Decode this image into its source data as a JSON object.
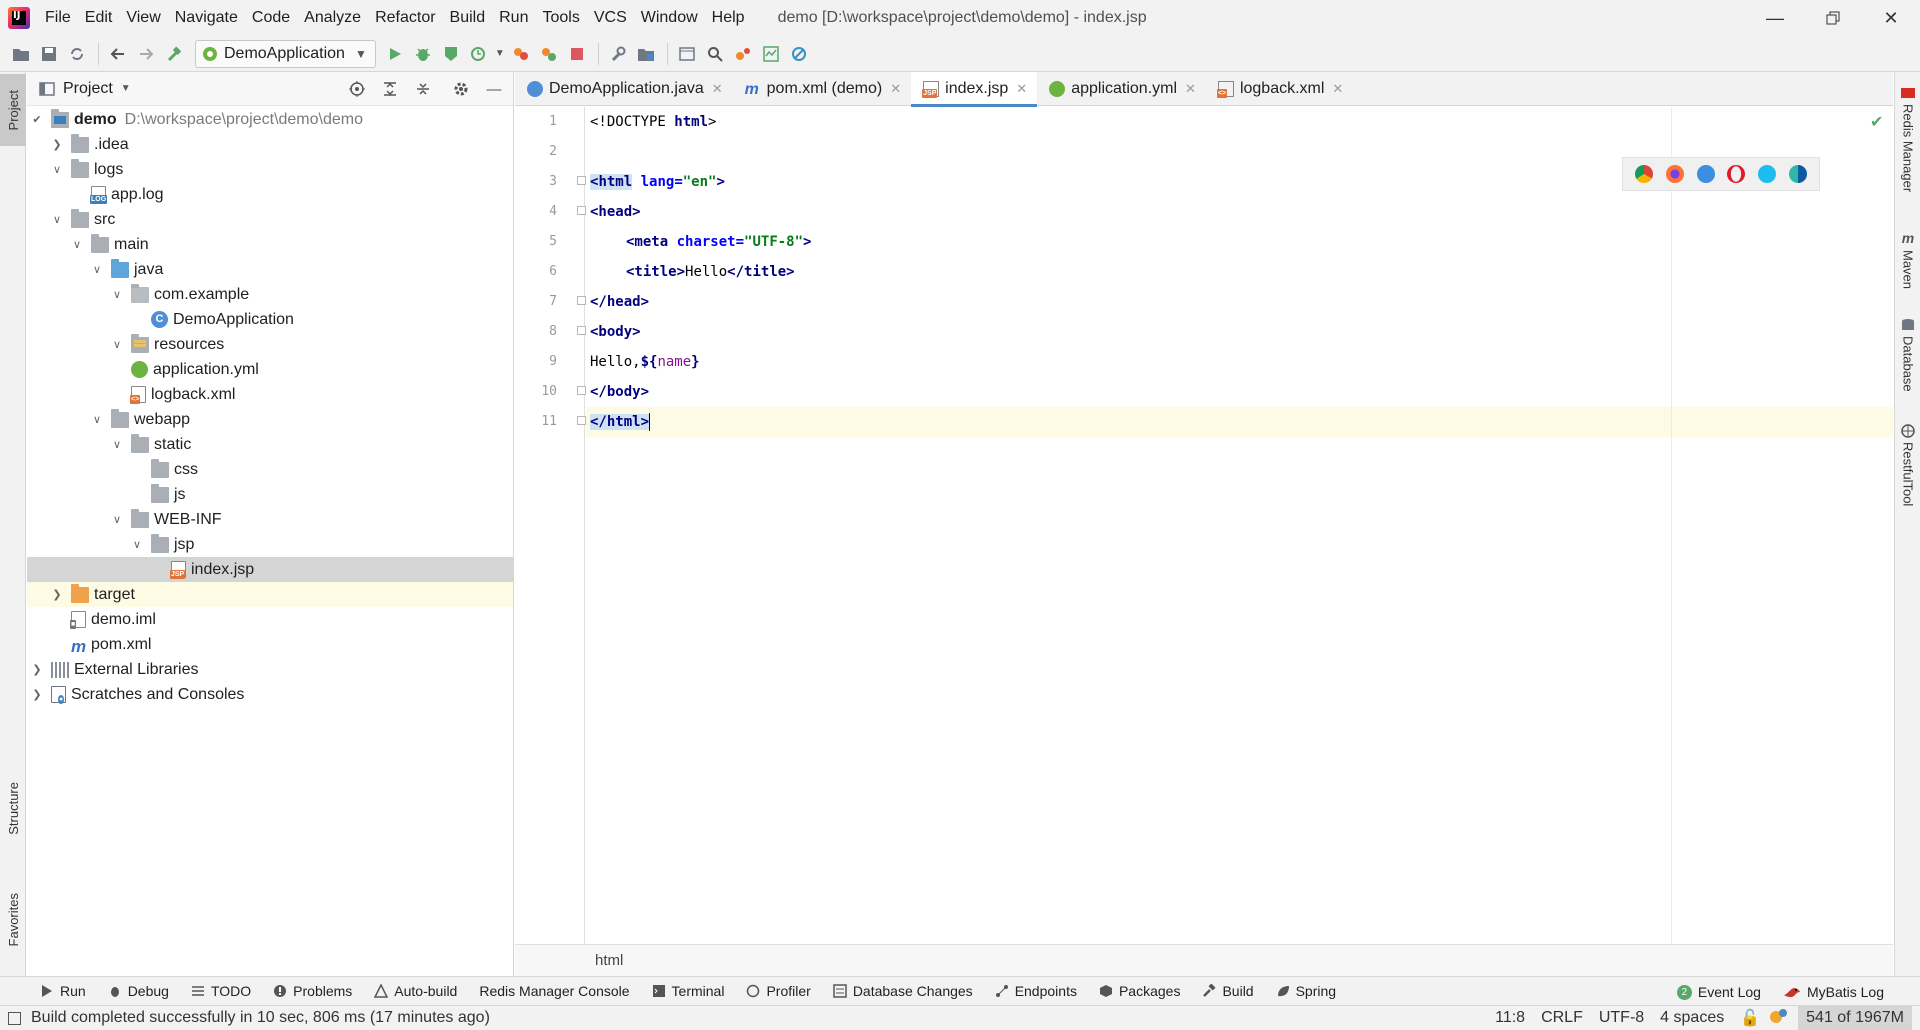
{
  "menu": {
    "items": [
      "File",
      "Edit",
      "View",
      "Navigate",
      "Code",
      "Analyze",
      "Refactor",
      "Build",
      "Run",
      "Tools",
      "VCS",
      "Window",
      "Help"
    ],
    "window_title": "demo [D:\\workspace\\project\\demo\\demo] - index.jsp"
  },
  "toolbar": {
    "run_config": "DemoApplication"
  },
  "left_stripe": {
    "project": "Project",
    "structure": "Structure",
    "favorites": "Favorites"
  },
  "right_stripe": {
    "redis": "Redis Manager",
    "maven": "Maven",
    "database": "Database",
    "restful": "RestfulTool"
  },
  "project_panel": {
    "title": "Project",
    "tree": [
      {
        "label": "demo",
        "path": "D:\\workspace\\project\\demo\\demo"
      },
      {
        "label": ".idea"
      },
      {
        "label": "logs"
      },
      {
        "label": "app.log"
      },
      {
        "label": "src"
      },
      {
        "label": "main"
      },
      {
        "label": "java"
      },
      {
        "label": "com.example"
      },
      {
        "label": "DemoApplication"
      },
      {
        "label": "resources"
      },
      {
        "label": "application.yml"
      },
      {
        "label": "logback.xml"
      },
      {
        "label": "webapp"
      },
      {
        "label": "static"
      },
      {
        "label": "css"
      },
      {
        "label": "js"
      },
      {
        "label": "WEB-INF"
      },
      {
        "label": "jsp"
      },
      {
        "label": "index.jsp"
      },
      {
        "label": "target"
      },
      {
        "label": "demo.iml"
      },
      {
        "label": "pom.xml"
      },
      {
        "label": "External Libraries"
      },
      {
        "label": "Scratches and Consoles"
      }
    ]
  },
  "editor": {
    "tabs": [
      {
        "label": "DemoApplication.java"
      },
      {
        "label": "pom.xml (demo)"
      },
      {
        "label": "index.jsp"
      },
      {
        "label": "application.yml"
      },
      {
        "label": "logback.xml"
      }
    ],
    "active_tab": "index.jsp",
    "line_numbers": [
      "1",
      "2",
      "3",
      "4",
      "5",
      "6",
      "7",
      "8",
      "9",
      "10",
      "11"
    ],
    "code": {
      "l1_doctype": "<!DOCTYPE ",
      "l1_html": "html",
      "l1_end": ">",
      "l3_open": "<",
      "l3_tag": "html",
      "l3_attr": " lang",
      "l3_eq": "=",
      "l3_val": "\"en\"",
      "l3_close": ">",
      "l4": "<head>",
      "l5_open": "<meta",
      "l5_attr": " charset",
      "l5_eq": "=",
      "l5_val": "\"UTF-8\"",
      "l5_close": ">",
      "l6_open": "<title>",
      "l6_text": "Hello",
      "l6_close": "</title>",
      "l7": "</head>",
      "l8": "<body>",
      "l9_text": "Hello,",
      "l9_el": "${",
      "l9_name": "name",
      "l9_end": "}",
      "l10": "</body>",
      "l11": "</html>"
    },
    "breadcrumb": "html"
  },
  "tool_windows": {
    "left": [
      "Run",
      "Debug",
      "TODO",
      "Problems",
      "Auto-build",
      "Redis Manager Console",
      "Terminal",
      "Profiler",
      "Database Changes",
      "Endpoints",
      "Packages",
      "Build",
      "Spring"
    ],
    "right": [
      "Event Log",
      "MyBatis Log"
    ],
    "event_log_count": "2"
  },
  "status": {
    "message": "Build completed successfully in 10 sec, 806 ms (17 minutes ago)",
    "position": "11:8",
    "line_sep": "CRLF",
    "encoding": "UTF-8",
    "indent": "4 spaces",
    "memory": "541 of 1967M"
  },
  "colors": {
    "accent": "#4a88c7",
    "run_green": "#59a869",
    "stop_red": "#db5860",
    "selection": "#d5d5d5",
    "current_line": "#fdfbe3"
  }
}
